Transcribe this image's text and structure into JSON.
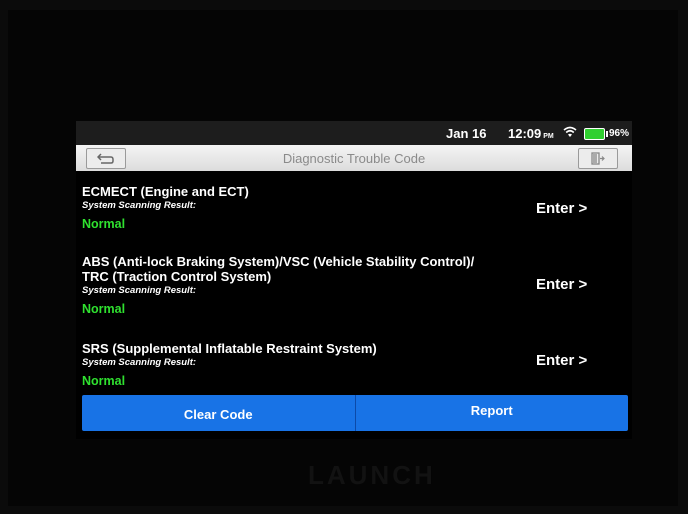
{
  "statusbar": {
    "date": "Jan 16",
    "time": "12:09",
    "ampm": "PM",
    "battery": "96%",
    "icons": [
      "wifi-icon",
      "battery-icon"
    ]
  },
  "titlebar": {
    "title": "Diagnostic Trouble Code",
    "back_icon": "back-arrow-icon",
    "exit_icon": "exit-icon"
  },
  "systems": [
    {
      "name_lines": [
        "ECMECT (Engine and ECT)"
      ],
      "result_label": "System Scanning Result:",
      "status": "Normal",
      "action": "Enter >"
    },
    {
      "name_lines": [
        "ABS (Anti-lock Braking System)/VSC (Vehicle Stability Control)/",
        "TRC (Traction Control System)"
      ],
      "result_label": "System Scanning Result:",
      "status": "Normal",
      "action": "Enter >"
    },
    {
      "name_lines": [
        "SRS (Supplemental Inflatable Restraint System)"
      ],
      "result_label": "System Scanning Result:",
      "status": "Normal",
      "action": "Enter >"
    }
  ],
  "buttons": {
    "clear": "Clear Code",
    "report": "Report"
  },
  "colors": {
    "accent": "#1873e6",
    "status_normal": "#2fe02f"
  },
  "device_brand": "LAUNCH"
}
